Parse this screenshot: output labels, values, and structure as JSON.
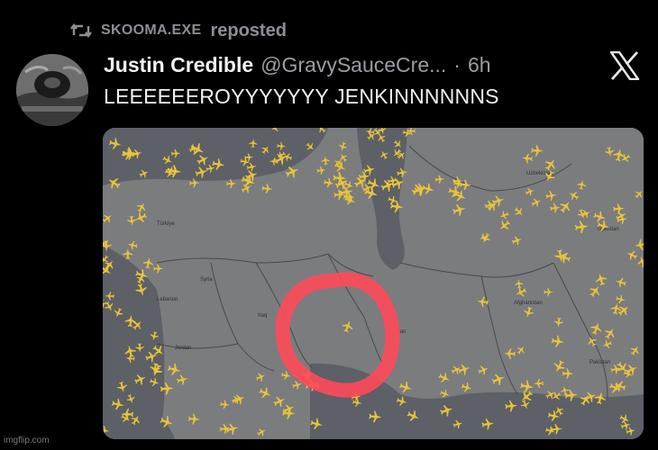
{
  "repost": {
    "icon": "repost-icon",
    "reposter": "SKOOMA.EXE",
    "suffix": "reposted"
  },
  "post": {
    "display_name": "Justin Credible",
    "handle": "@GravySauceCre...",
    "separator": "·",
    "time": "6h",
    "text": "LEEEEEEROYYYYYYY JENKINNNNNNS"
  },
  "map": {
    "labels": {
      "turkey": "Türkiye",
      "syria": "Syria",
      "lebanon": "Lebanon",
      "iraq": "Iraq",
      "jordan": "Jordan",
      "iran": "Iran",
      "uzbekistan": "Uzbekistan",
      "tajikistan": "Tajikistan",
      "afghanistan": "Afghanistan",
      "pakistan": "Pakistan"
    },
    "colors": {
      "land": "#7b7c7e",
      "sea": "#5d6066",
      "plane": "#e8c43a",
      "circle": "#ff4a5a"
    }
  },
  "watermark": "imgflip.com"
}
